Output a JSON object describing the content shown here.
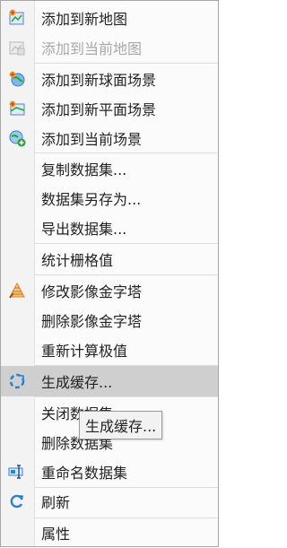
{
  "colors": {
    "hover_background": "#cfcfcf",
    "disabled_text": "#a8a8a8",
    "icon_blue": "#2f7fd0",
    "icon_orange": "#e07a20",
    "icon_green": "#2e9e3e",
    "icon_red": "#d83030"
  },
  "menu": {
    "items": [
      {
        "label": "添加到新地图",
        "icon": "map-new-icon"
      },
      {
        "label": "添加到当前地图",
        "icon": "map-current-icon",
        "disabled": true
      },
      {
        "label": "添加到新球面场景",
        "icon": "globe-scene-icon"
      },
      {
        "label": "添加到新平面场景",
        "icon": "flat-scene-icon"
      },
      {
        "label": "添加到当前场景",
        "icon": "add-current-scene-icon"
      },
      {
        "label": "复制数据集..."
      },
      {
        "label": "数据集另存为..."
      },
      {
        "label": "导出数据集..."
      },
      {
        "label": "统计栅格值"
      },
      {
        "label": "修改影像金字塔",
        "icon": "pyramid-icon"
      },
      {
        "label": "删除影像金字塔"
      },
      {
        "label": "重新计算极值"
      },
      {
        "label": "生成缓存...",
        "icon": "cache-icon",
        "hovered": true
      },
      {
        "label": "关闭数据集"
      },
      {
        "label": "删除数据集"
      },
      {
        "label": "重命名数据集",
        "icon": "rename-icon"
      },
      {
        "label": "刷新",
        "icon": "refresh-icon"
      },
      {
        "label": "属性"
      }
    ]
  },
  "tooltip": {
    "text": "生成缓存..."
  }
}
